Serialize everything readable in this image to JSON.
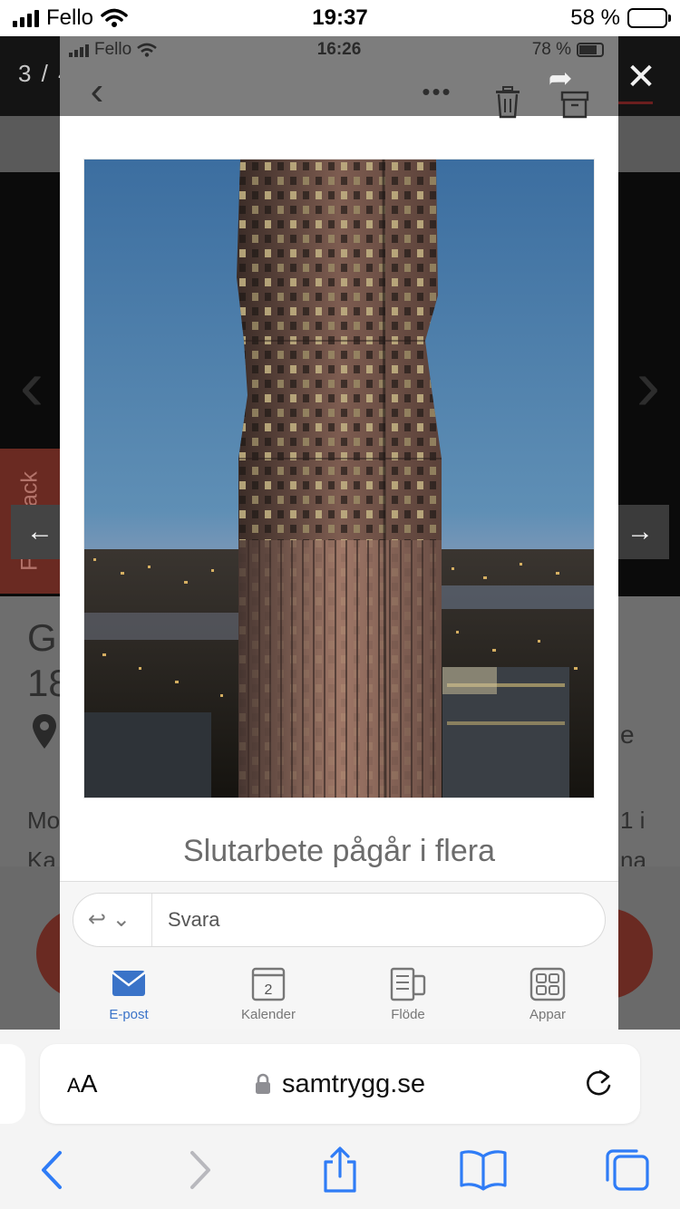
{
  "status_bar": {
    "carrier": "Fello",
    "time": "19:37",
    "battery_text": "58 %",
    "battery_level": 0.58
  },
  "gallery": {
    "counter": "3 / 4"
  },
  "background_page": {
    "feedback_label": "Feedback",
    "heading_fragments": [
      "G",
      "18"
    ],
    "text_fragments": [
      "e",
      "Mo",
      "1 i",
      "Ka",
      "na"
    ]
  },
  "screenshot": {
    "status_bar": {
      "carrier": "Fello",
      "time": "16:26",
      "battery_text": "78 %",
      "battery_level": 0.78
    },
    "caption": "Slutarbete pågår i flera",
    "reply_placeholder": "Svara",
    "tabs": [
      {
        "label": "E-post",
        "icon": "mail-icon",
        "active": true
      },
      {
        "label": "Kalender",
        "icon": "calendar-icon",
        "day": "2",
        "active": false
      },
      {
        "label": "Flöde",
        "icon": "feed-icon",
        "active": false
      },
      {
        "label": "Appar",
        "icon": "apps-grid-icon",
        "active": false
      }
    ]
  },
  "safari": {
    "url": "samtrygg.se",
    "text_size_label_small": "A",
    "text_size_label_large": "A"
  },
  "colors": {
    "accent_blue": "#3a73c8",
    "ios_blue": "#2f7cf6",
    "brand_red": "#6a2a22"
  }
}
